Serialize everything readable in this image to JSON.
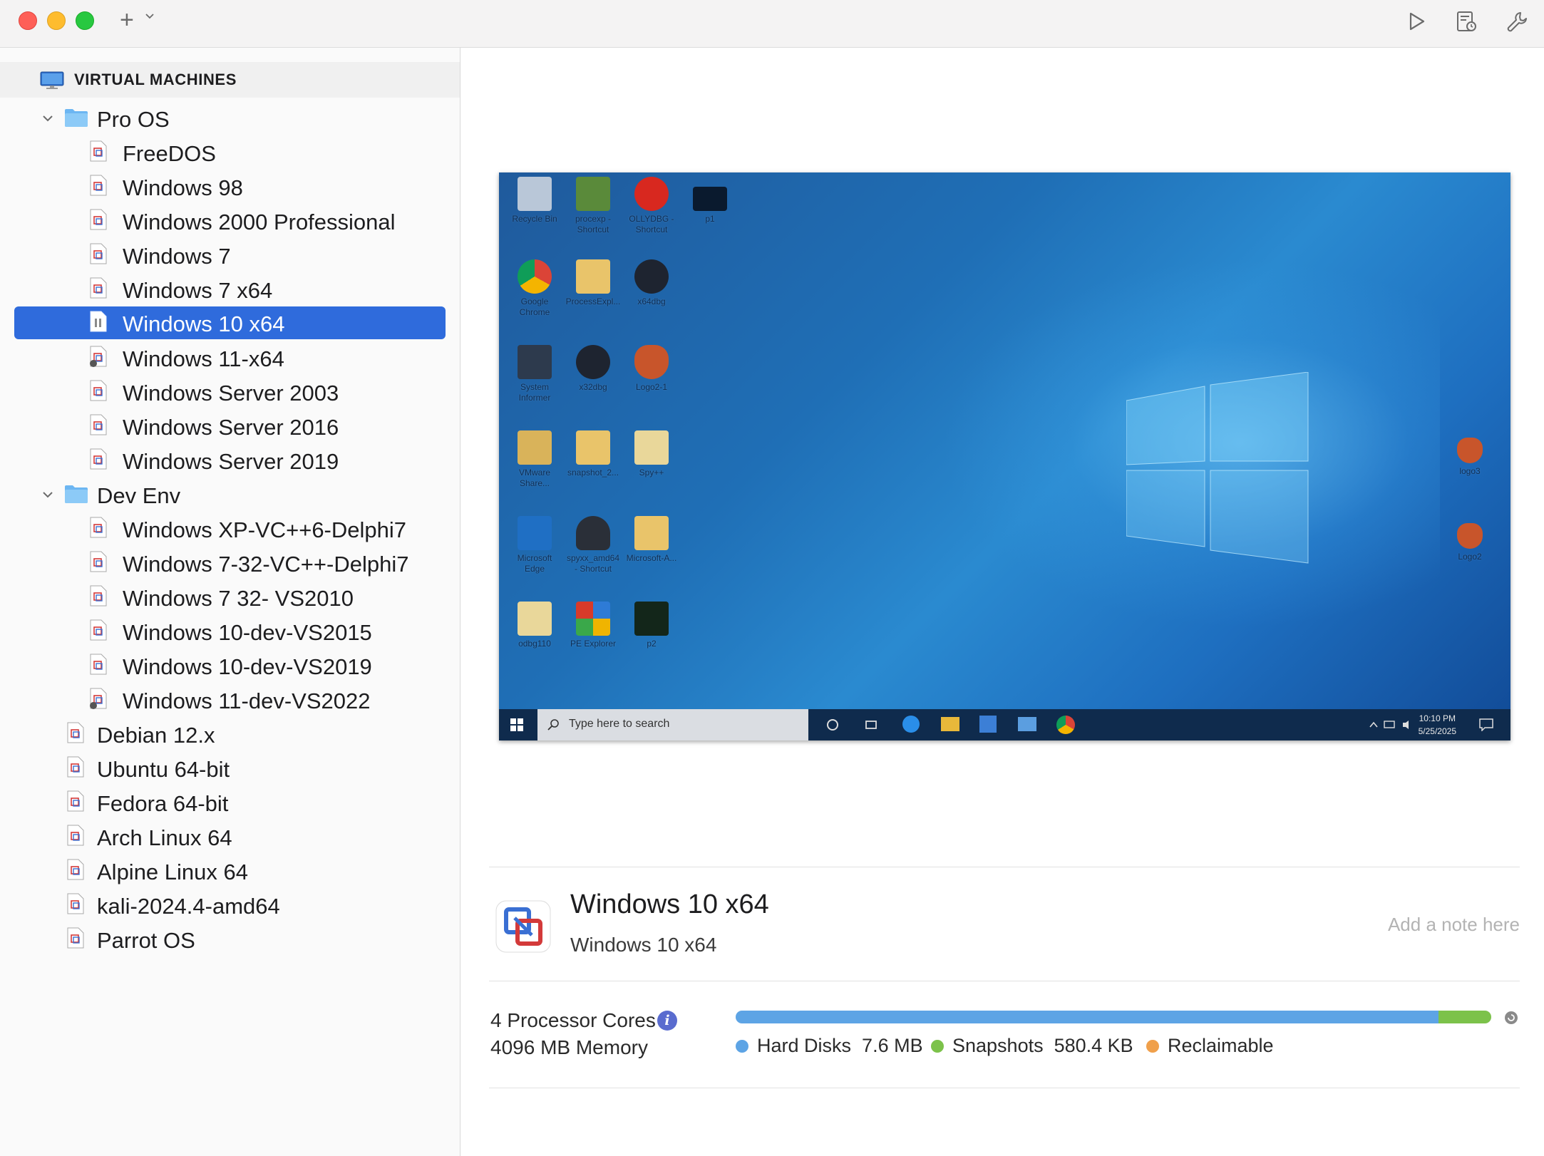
{
  "toolbar": {
    "add": "+"
  },
  "sidebar": {
    "header": "VIRTUAL MACHINES",
    "groups": [
      {
        "label": "Pro OS",
        "expanded": true,
        "items": [
          "FreeDOS",
          "Windows 98",
          "Windows 2000 Professional",
          "Windows 7",
          "Windows 7 x64",
          "Windows 10 x64",
          "Windows 11-x64",
          "Windows Server 2003",
          "Windows Server 2016",
          "Windows Server 2019"
        ]
      },
      {
        "label": "Dev Env",
        "expanded": true,
        "items": [
          "Windows XP-VC++6-Delphi7",
          "Windows 7-32-VC++-Delphi7",
          "Windows 7 32- VS2010",
          "Windows 10-dev-VS2015",
          "Windows 10-dev-VS2019",
          "Windows 11-dev-VS2022"
        ]
      }
    ],
    "items": [
      "Debian 12.x",
      "Ubuntu 64-bit",
      "Fedora 64-bit",
      "Arch Linux 64",
      "Alpine Linux 64",
      "kali-2024.4-amd64",
      "Parrot OS"
    ],
    "selected": "Windows 10 x64"
  },
  "preview": {
    "desktop_icons": [
      "Recycle Bin",
      "procexp - Shortcut",
      "OLLYDBG - Shortcut",
      "p1",
      "Google Chrome",
      "ProcessExpl...",
      "x64dbg",
      "System Informer",
      "x32dbg",
      "Logo2-1",
      "VMware Share...",
      "snapshot_2...",
      "Spy++",
      "Microsoft Edge",
      "spyxx_amd64 - Shortcut",
      "Microsoft-A...",
      "odbg110",
      "PE Explorer",
      "p2",
      "logo3",
      "Logo2"
    ],
    "taskbar": {
      "search_placeholder": "Type here to search",
      "time": "10:10 PM",
      "date": "5/25/2025"
    }
  },
  "details": {
    "title": "Windows 10 x64",
    "subtitle": "Windows 10 x64",
    "note_placeholder": "Add a note here",
    "cpu": "4 Processor Cores",
    "memory": "4096 MB Memory",
    "info_icon": "i",
    "storage": {
      "hard_disks_label": "Hard Disks",
      "hard_disks_value": "7.6 MB",
      "snapshots_label": "Snapshots",
      "snapshots_value": "580.4 KB",
      "reclaimable_label": "Reclaimable",
      "usage_fraction_hard_disks": 0.93,
      "usage_fraction_snapshots": 0.07
    }
  },
  "colors": {
    "selection": "#2f6bdc",
    "hard_disks": "#5da4e5",
    "snapshots": "#7cc24a",
    "reclaimable": "#f0a04b"
  }
}
